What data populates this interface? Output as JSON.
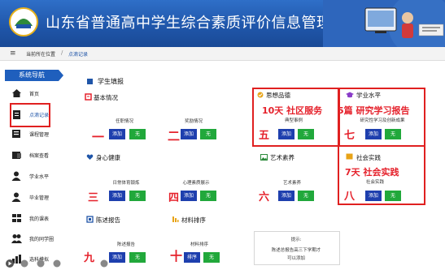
{
  "header": {
    "title": "山东省普通高中学生综合素质评价信息管理系统"
  },
  "breadcrumb": {
    "current_label": "当前所在位置",
    "page": "点滴记录"
  },
  "sidebar": {
    "title": "系统导航",
    "items": [
      {
        "label": "首页",
        "icon": "home-icon"
      },
      {
        "label": "点滴记录",
        "icon": "clipboard-icon"
      },
      {
        "label": "课程管理",
        "icon": "book-icon"
      },
      {
        "label": "档案查看",
        "icon": "folder-icon"
      },
      {
        "label": "学业水平",
        "icon": "user-icon"
      },
      {
        "label": "毕业管理",
        "icon": "user-icon"
      },
      {
        "label": "我的课表",
        "icon": "calendar-icon"
      },
      {
        "label": "我的同学圈",
        "icon": "users-icon"
      },
      {
        "label": "选科模拟",
        "icon": "chart-icon"
      }
    ]
  },
  "main": {
    "heading": "学生填报",
    "sections": {
      "basic": "基本情况",
      "health": "身心健康",
      "report": "陈述报告",
      "material": "材料排序",
      "moral": "思想品德",
      "academic": "学业水平",
      "art": "艺术素养",
      "social": "社会实践"
    },
    "cards": {
      "c1": {
        "sub": "任职情况",
        "num": "一"
      },
      "c2": {
        "sub": "奖励情况",
        "num": "二"
      },
      "c3": {
        "sub": "日常体育锻炼",
        "num": "三"
      },
      "c4": {
        "sub": "心理素质展示",
        "num": "四"
      },
      "c5": {
        "sub": "典型事例",
        "num": "五",
        "big": "10天 社区服务"
      },
      "c6": {
        "sub": "艺术素养",
        "num": "六"
      },
      "c7": {
        "sub": "研究性学习及创新成果",
        "num": "七",
        "big": "5篇 研究学习报告"
      },
      "c8": {
        "sub": "社会实践",
        "num": "八",
        "big": "7天 社会实践"
      },
      "c9": {
        "sub": "陈述报告",
        "num": "九"
      },
      "c10": {
        "sub": "材料排序",
        "num": "十"
      }
    },
    "buttons": {
      "add": "添加",
      "none": "无",
      "sort": "排序"
    },
    "hint": {
      "title": "提示:",
      "line1": "陈述总报告高三下学期才",
      "line2": "可以添加"
    }
  }
}
